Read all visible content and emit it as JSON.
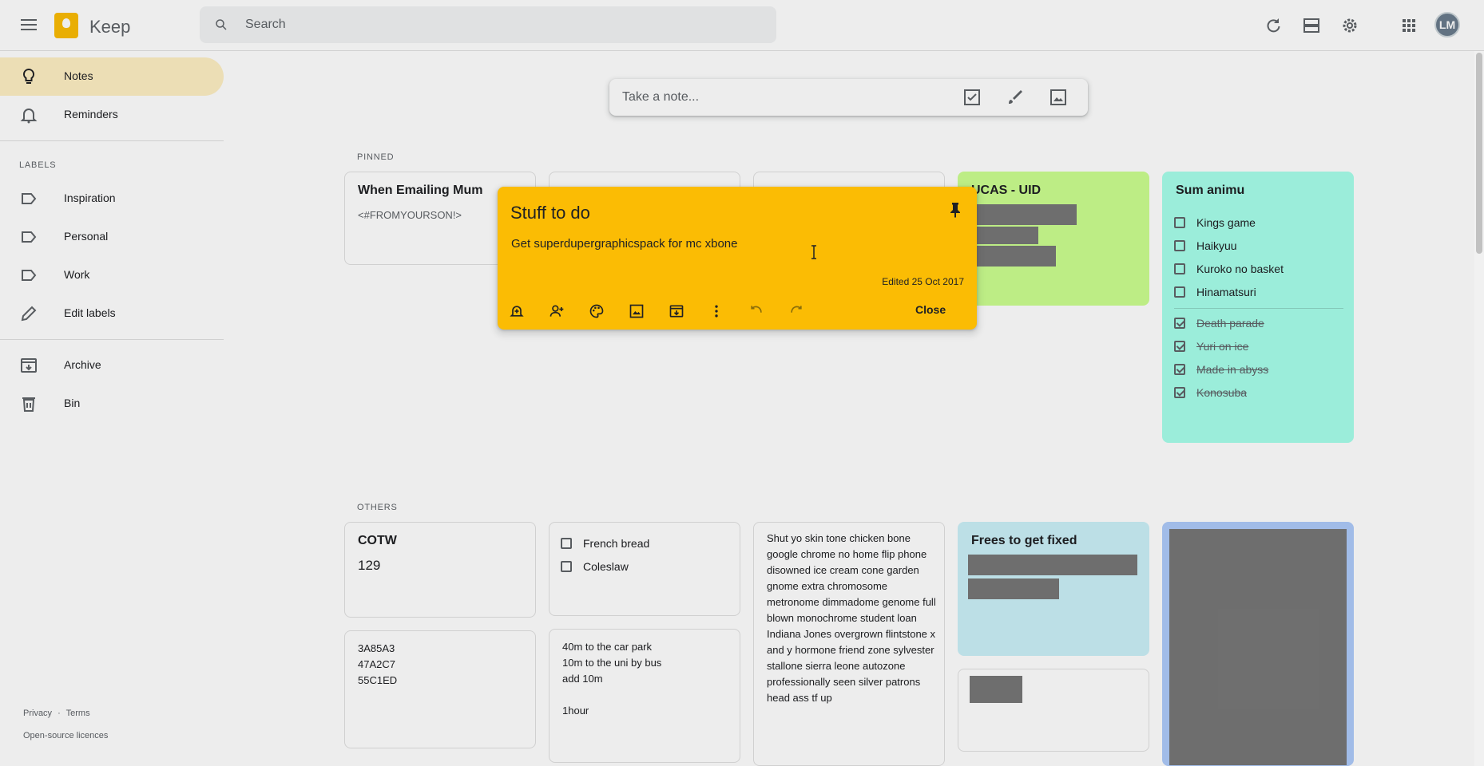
{
  "app": {
    "name": "Keep"
  },
  "search": {
    "placeholder": "Search"
  },
  "header": {
    "avatar_initials": "LM",
    "icons": [
      "refresh-icon",
      "list-view-icon",
      "settings-icon",
      "apps-icon"
    ]
  },
  "sidebar": {
    "items": [
      {
        "label": "Notes",
        "icon": "bulb-icon"
      },
      {
        "label": "Reminders",
        "icon": "bell-icon"
      }
    ],
    "labels_heading": "LABELS",
    "labels": [
      "Inspiration",
      "Personal",
      "Work"
    ],
    "edit_labels": "Edit labels",
    "archive": "Archive",
    "bin": "Bin",
    "footer": {
      "privacy": "Privacy",
      "separator": "·",
      "terms": "Terms",
      "licences": "Open-source licences"
    }
  },
  "take_note": {
    "placeholder": "Take a note..."
  },
  "sections": {
    "pinned": "PINNED",
    "others": "OTHERS"
  },
  "pinned_notes": {
    "mum": {
      "title": "When Emailing Mum",
      "body": "<#FROMYOURSON!>"
    },
    "ucas": {
      "title": "UCAS - UID"
    },
    "animu": {
      "title": "Sum animu",
      "unchecked": [
        "Kings game",
        "Haikyuu",
        "Kuroko no basket",
        "Hinamatsuri"
      ],
      "checked": [
        "Death parade",
        "Yuri on ice",
        "Made in abyss",
        "Konosuba"
      ]
    }
  },
  "other_notes": {
    "cotw": {
      "title": "COTW",
      "body": "129"
    },
    "shopping": {
      "items": [
        "French bread",
        "Coleslaw"
      ]
    },
    "poem": {
      "body": "Shut yo skin tone chicken bone google chrome no home flip phone disowned ice cream cone garden gnome extra chromosome metronome dimmadome genome full blown monochrome student loan Indiana Jones overgrown flintstone x and y hormone friend zone sylvester stallone sierra leone autozone professionally seen silver patrons head ass tf up"
    },
    "frees": {
      "title": "Frees to get fixed"
    },
    "hex": {
      "body": "3A85A3\n47A2C7\n55C1ED"
    },
    "travel": {
      "body": "40m to the car park\n10m to the uni by bus\nadd 10m\n\n1hour"
    }
  },
  "modal": {
    "title": "Stuff to do",
    "body": "Get superdupergraphicspack for mc xbone",
    "edited": "Edited 25 Oct 2017",
    "close": "Close",
    "bg_color": "#fbbc04"
  }
}
